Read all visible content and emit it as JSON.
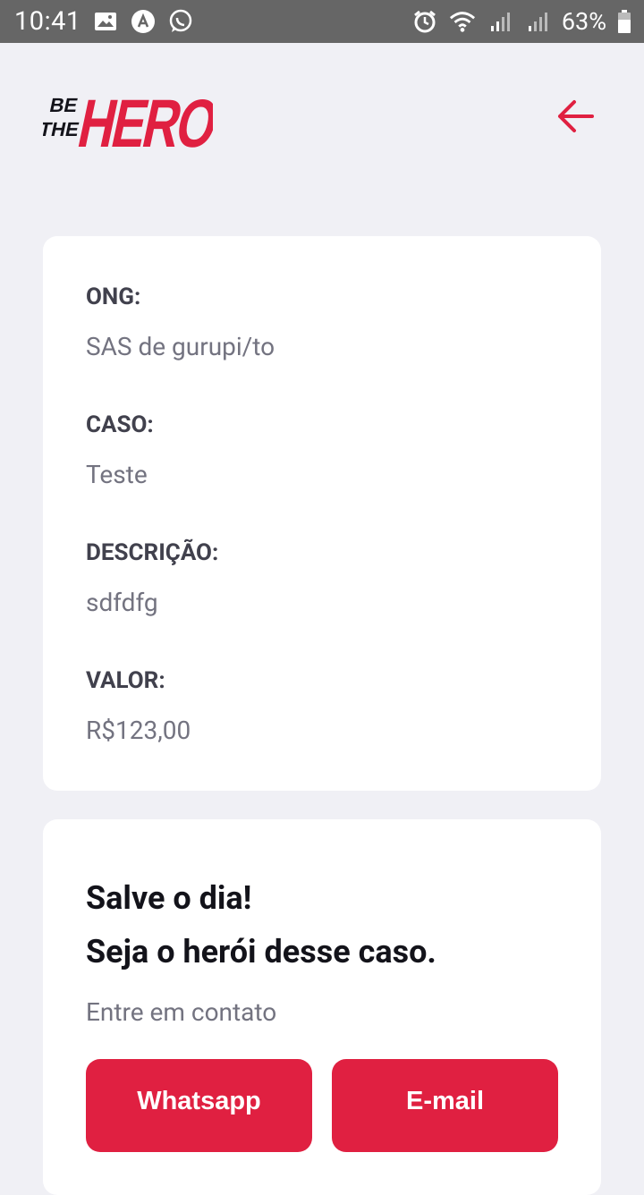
{
  "status_bar": {
    "time": "10:41",
    "battery_percent": "63%",
    "left_icons": [
      "image-icon",
      "app-icon",
      "whatsapp-icon"
    ],
    "right_icons": [
      "alarm-icon",
      "wifi-icon",
      "signal-icon",
      "signal-icon",
      "battery-icon"
    ]
  },
  "header": {
    "logo_text_small_1": "BE",
    "logo_text_small_2": "THE",
    "logo_text_big": "HERO"
  },
  "incident": {
    "ong_label": "ONG:",
    "ong_value": "SAS de gurupi/to",
    "case_label": "CASO:",
    "case_value": "Teste",
    "description_label": "DESCRIÇÃO:",
    "description_value": "sdfdfg",
    "value_label": "VALOR:",
    "value_value": "R$123,00"
  },
  "contact": {
    "title_line1": "Salve o dia!",
    "title_line2": "Seja o herói desse caso.",
    "description": "Entre em contato",
    "whatsapp_label": "Whatsapp",
    "email_label": "E-mail"
  },
  "colors": {
    "accent": "#e02041",
    "background": "#f0f0f5",
    "label": "#41414d",
    "value": "#737380",
    "title": "#13131a",
    "statusbar": "#666666"
  }
}
